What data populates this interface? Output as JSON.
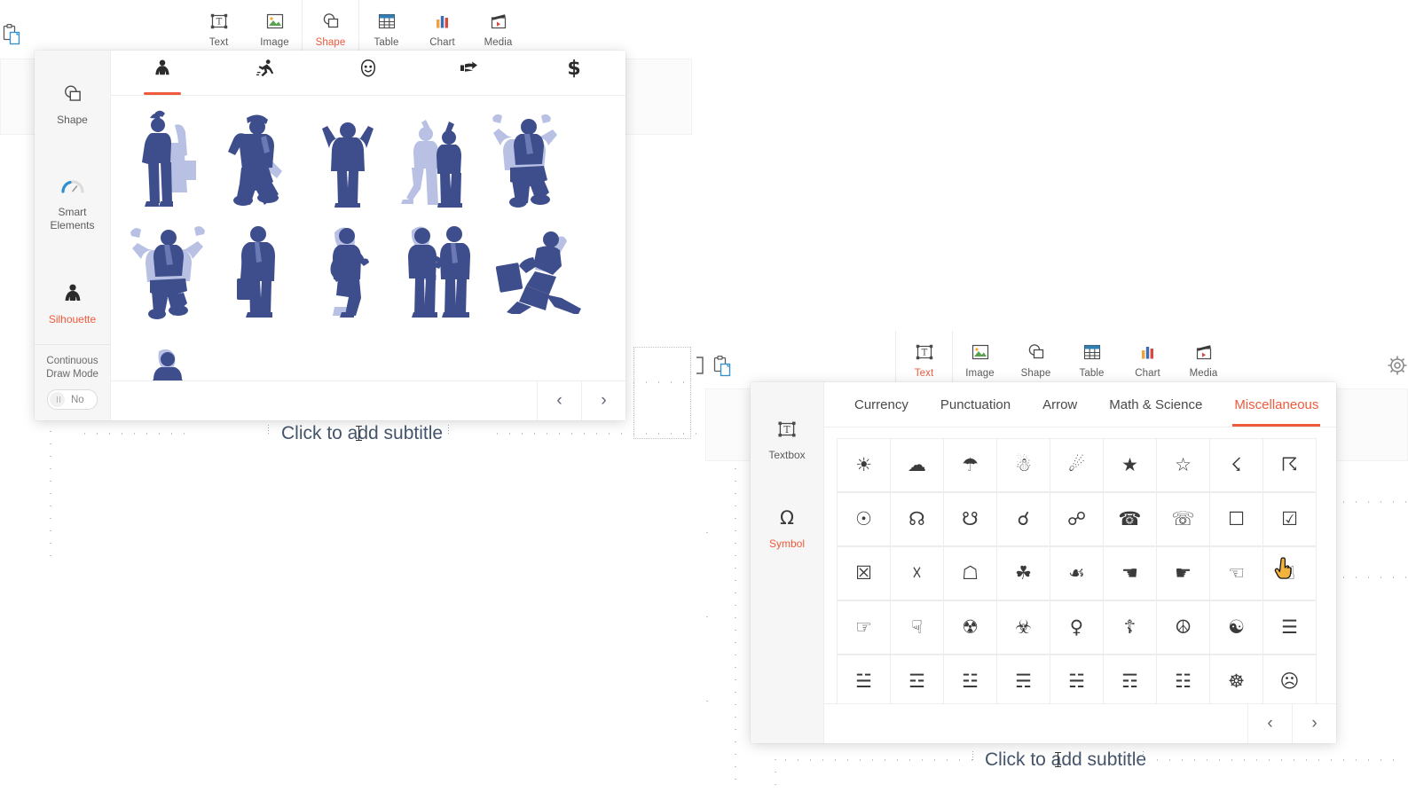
{
  "app": {
    "accent": "#ef5a3d",
    "silhouette_dark": "#3e4e8c",
    "silhouette_light": "#b8c1e3",
    "subtitle_color": "#44546a"
  },
  "ribbon_left": {
    "items": [
      {
        "label": "Text",
        "icon": "textbox-icon",
        "active": false
      },
      {
        "label": "Image",
        "icon": "image-icon",
        "active": false
      },
      {
        "label": "Shape",
        "icon": "shape-icon",
        "active": true
      },
      {
        "label": "Table",
        "icon": "table-icon",
        "active": false
      },
      {
        "label": "Chart",
        "icon": "chart-icon",
        "active": false
      },
      {
        "label": "Media",
        "icon": "media-icon",
        "active": false
      }
    ]
  },
  "ribbon_right": {
    "items": [
      {
        "label": "Text",
        "icon": "textbox-icon",
        "active": true
      },
      {
        "label": "Image",
        "icon": "image-icon",
        "active": false
      },
      {
        "label": "Shape",
        "icon": "shape-icon",
        "active": false
      },
      {
        "label": "Table",
        "icon": "table-icon",
        "active": false
      },
      {
        "label": "Chart",
        "icon": "chart-icon",
        "active": false
      },
      {
        "label": "Media",
        "icon": "media-icon",
        "active": false
      }
    ]
  },
  "shape_panel": {
    "rail": {
      "items": [
        {
          "label": "Shape",
          "icon": "shape-icon",
          "active": false
        },
        {
          "label": "Smart Elements",
          "icon": "gauge-icon",
          "active": false
        },
        {
          "label": "Silhouette",
          "icon": "silhouette-icon",
          "active": true
        }
      ],
      "footer": {
        "label": "Continuous Draw Mode",
        "toggle_value": "No",
        "toggle_on": false
      }
    },
    "category_tabs": [
      {
        "name": "person-standing-icon",
        "active": true
      },
      {
        "name": "person-running-icon",
        "active": false
      },
      {
        "name": "smiley-face-icon",
        "active": false
      },
      {
        "name": "pointing-hand-icon",
        "active": false
      },
      {
        "name": "dollar-sign-icon",
        "active": false
      }
    ],
    "items": [
      {
        "name": "silhouette-man-waving-briefcase"
      },
      {
        "name": "silhouette-man-jumping-hat"
      },
      {
        "name": "silhouette-woman-arms-up"
      },
      {
        "name": "silhouette-two-people-high-five"
      },
      {
        "name": "silhouette-man-jumping-tie"
      },
      {
        "name": "silhouette-man-jumping-hands-up"
      },
      {
        "name": "silhouette-man-standing-briefcase"
      },
      {
        "name": "silhouette-woman-presenting"
      },
      {
        "name": "silhouette-two-people-meeting"
      },
      {
        "name": "silhouette-man-running-briefcase"
      },
      {
        "name": "silhouette-woman-standing-folder"
      }
    ],
    "pager": {
      "prev": "‹",
      "next": "›"
    }
  },
  "symbol_panel": {
    "rail": {
      "items": [
        {
          "label": "Textbox",
          "icon": "textbox-icon",
          "active": false
        },
        {
          "label": "Symbol",
          "icon": "omega-icon",
          "active": true
        }
      ]
    },
    "category_tabs": [
      {
        "label": "Currency",
        "active": false
      },
      {
        "label": "Punctuation",
        "active": false
      },
      {
        "label": "Arrow",
        "active": false
      },
      {
        "label": "Math & Science",
        "active": false
      },
      {
        "label": "Miscellaneous",
        "active": true
      }
    ],
    "symbols": [
      {
        "glyph": "☀",
        "name": "sun-symbol"
      },
      {
        "glyph": "☁",
        "name": "cloud-symbol"
      },
      {
        "glyph": "☂",
        "name": "umbrella-symbol"
      },
      {
        "glyph": "☃",
        "name": "snowman-symbol"
      },
      {
        "glyph": "☄",
        "name": "comet-symbol"
      },
      {
        "glyph": "★",
        "name": "black-star-symbol"
      },
      {
        "glyph": "☆",
        "name": "white-star-symbol"
      },
      {
        "glyph": "☇",
        "name": "lightning-symbol"
      },
      {
        "glyph": "☈",
        "name": "thunderstorm-symbol"
      },
      {
        "glyph": "☉",
        "name": "sun-with-rays-symbol"
      },
      {
        "glyph": "☊",
        "name": "ascending-node-symbol"
      },
      {
        "glyph": "☋",
        "name": "descending-node-symbol"
      },
      {
        "glyph": "☌",
        "name": "conjunction-symbol"
      },
      {
        "glyph": "☍",
        "name": "opposition-symbol"
      },
      {
        "glyph": "☎",
        "name": "black-telephone-symbol"
      },
      {
        "glyph": "☏",
        "name": "white-telephone-symbol"
      },
      {
        "glyph": "☐",
        "name": "ballot-box-symbol"
      },
      {
        "glyph": "☑",
        "name": "ballot-box-check-symbol"
      },
      {
        "glyph": "☒",
        "name": "ballot-box-x-symbol"
      },
      {
        "glyph": "☓",
        "name": "saltire-symbol"
      },
      {
        "glyph": "☖",
        "name": "white-shogi-piece-symbol"
      },
      {
        "glyph": "☘",
        "name": "shamrock-symbol"
      },
      {
        "glyph": "☙",
        "name": "reversed-rotated-floral-heart-symbol"
      },
      {
        "glyph": "☚",
        "name": "black-left-pointing-index-symbol"
      },
      {
        "glyph": "☛",
        "name": "black-right-pointing-index-symbol"
      },
      {
        "glyph": "☜",
        "name": "white-left-pointing-index-symbol"
      },
      {
        "glyph": "☝",
        "name": "white-up-pointing-index-symbol"
      },
      {
        "glyph": "☞",
        "name": "white-right-pointing-index-symbol"
      },
      {
        "glyph": "☟",
        "name": "white-down-pointing-index-symbol"
      },
      {
        "glyph": "☢",
        "name": "radioactive-symbol"
      },
      {
        "glyph": "☣",
        "name": "biohazard-symbol"
      },
      {
        "glyph": "♀",
        "name": "female-sign-symbol"
      },
      {
        "glyph": "☦",
        "name": "orthodox-cross-symbol"
      },
      {
        "glyph": "☮",
        "name": "peace-symbol"
      },
      {
        "glyph": "☯",
        "name": "yin-yang-symbol"
      },
      {
        "glyph": "☰",
        "name": "trigram-heaven-symbol"
      },
      {
        "glyph": "☱",
        "name": "trigram-lake-symbol"
      },
      {
        "glyph": "☲",
        "name": "trigram-fire-symbol"
      },
      {
        "glyph": "☳",
        "name": "trigram-thunder-symbol"
      },
      {
        "glyph": "☴",
        "name": "trigram-wind-symbol"
      },
      {
        "glyph": "☵",
        "name": "trigram-water-symbol"
      },
      {
        "glyph": "☶",
        "name": "trigram-mountain-symbol"
      },
      {
        "glyph": "☷",
        "name": "trigram-earth-symbol"
      },
      {
        "glyph": "☸",
        "name": "wheel-of-dharma-symbol"
      },
      {
        "glyph": "☹",
        "name": "frowning-face-symbol"
      }
    ],
    "pager": {
      "prev": "‹",
      "next": "›"
    }
  },
  "slide_left": {
    "subtitle_placeholder": "Click to add subtitle"
  },
  "slide_right": {
    "subtitle_placeholder": "Click to add subtitle"
  }
}
